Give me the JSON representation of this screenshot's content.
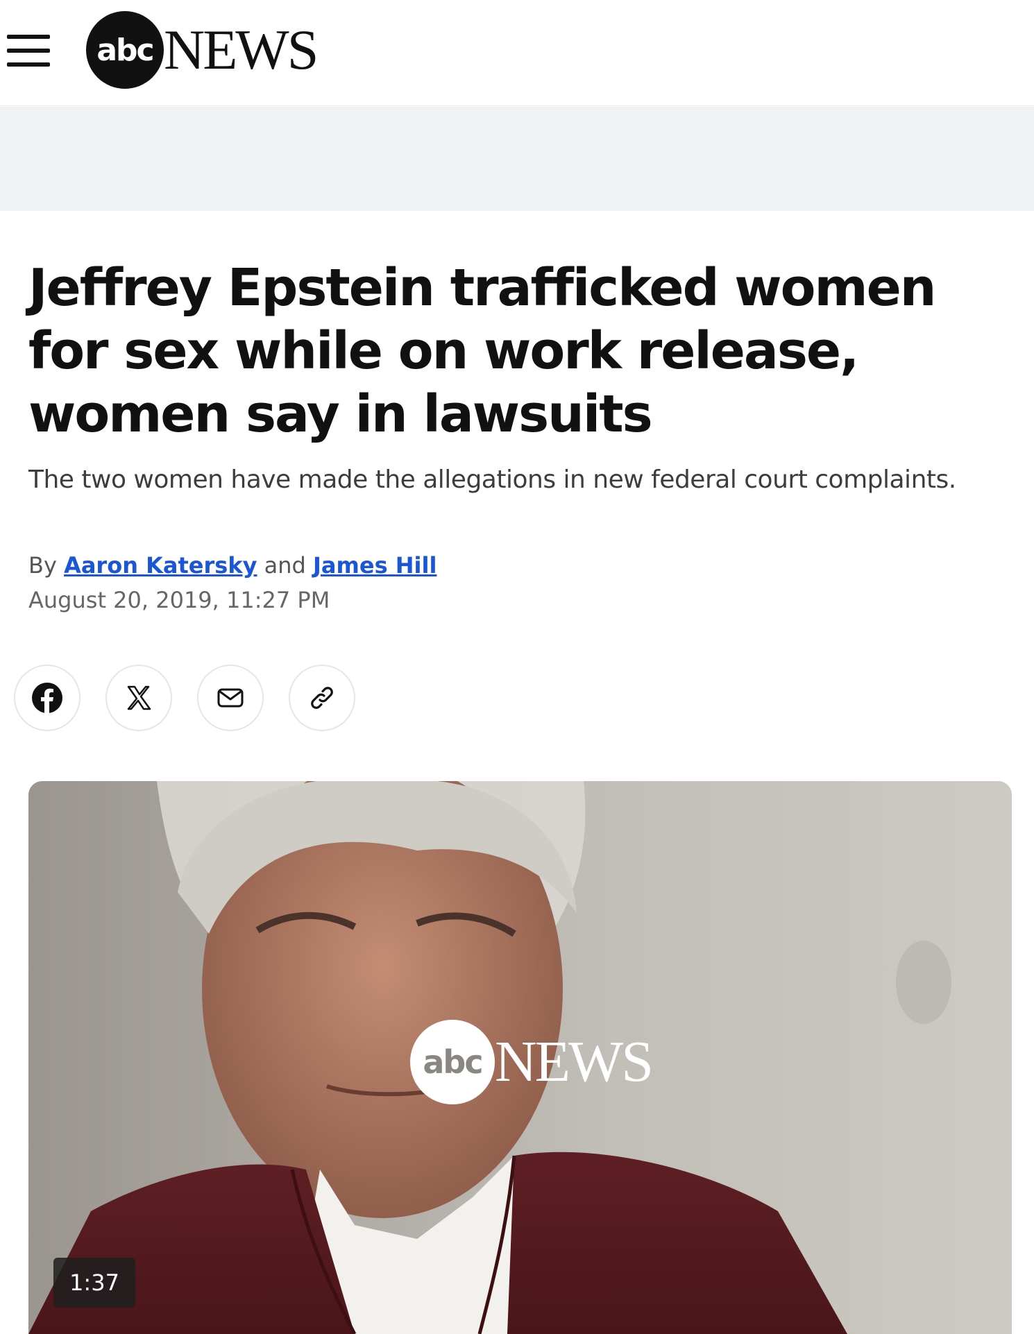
{
  "header": {
    "logo_abc": "abc",
    "logo_news": "NEWS"
  },
  "article": {
    "headline": "Jeffrey Epstein trafficked women for sex while on work release, women say in lawsuits",
    "subheadline": "The two women have made the allegations in new federal court complaints.",
    "byline_prefix": "By",
    "author_1": "Aaron Katersky",
    "byline_joiner": "and",
    "author_2": "James Hill",
    "date": "August 20, 2019, 11:27 PM"
  },
  "share": {
    "icons": [
      "facebook-icon",
      "x-icon",
      "mail-icon",
      "link-icon"
    ]
  },
  "video": {
    "logo_abc": "abc",
    "logo_news": "NEWS",
    "duration": "1:37"
  },
  "colors": {
    "link": "#1a56d6",
    "ad_band": "#f0f2f3"
  }
}
